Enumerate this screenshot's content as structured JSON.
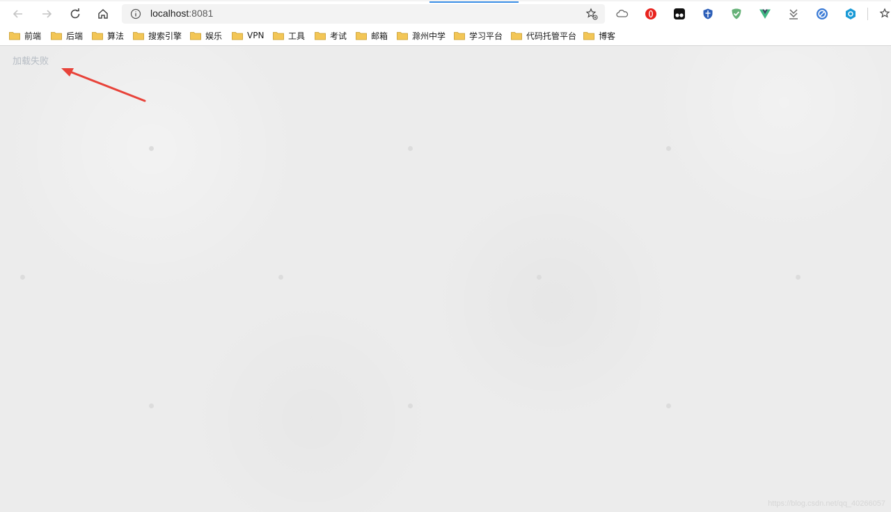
{
  "browser": {
    "address_bar": {
      "url_host": "localhost",
      "url_port": ":8081"
    }
  },
  "bookmarks": [
    {
      "label": "前端"
    },
    {
      "label": "后端"
    },
    {
      "label": "算法"
    },
    {
      "label": "搜索引擎"
    },
    {
      "label": "娱乐"
    },
    {
      "label": "VPN"
    },
    {
      "label": "工具"
    },
    {
      "label": "考试"
    },
    {
      "label": "邮箱"
    },
    {
      "label": "滁州中学"
    },
    {
      "label": "学习平台"
    },
    {
      "label": "代码托管平台"
    },
    {
      "label": "博客"
    }
  ],
  "page": {
    "status_text": "加载失败",
    "watermark": "https://blog.csdn.net/qq_40266057"
  },
  "colors": {
    "accent": "#3a8ee6",
    "page_background": "#ececec",
    "status_text": "#b6bcc4",
    "arrow": "#e8433a"
  }
}
